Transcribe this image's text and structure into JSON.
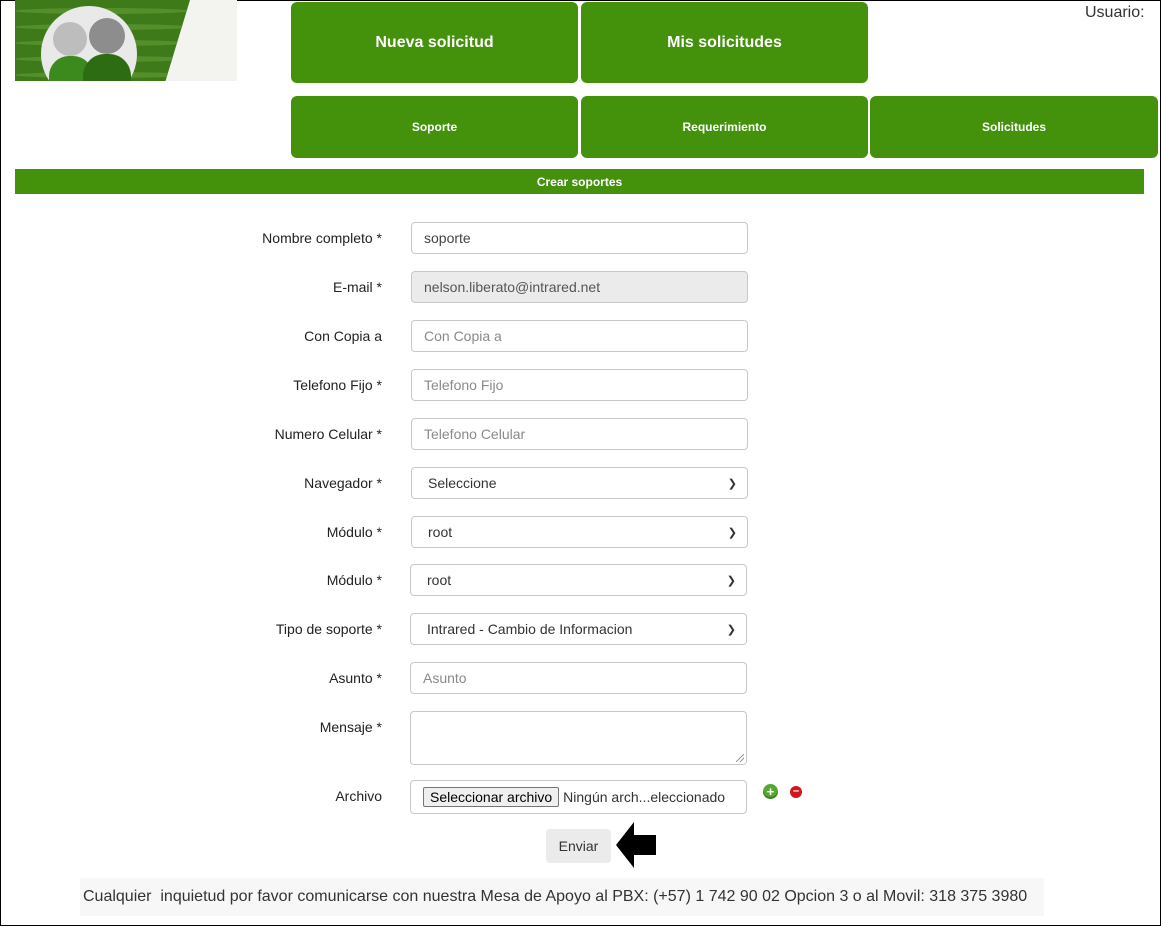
{
  "header": {
    "usuario_label": "Usuario:",
    "nav_top": [
      "Nueva solicitud",
      "Mis solicitudes"
    ],
    "nav_sub": [
      "Soporte",
      "Requerimiento",
      "Solicitudes"
    ],
    "brand_color": "#44910c"
  },
  "section_title": "Crear soportes",
  "form": {
    "nombre": {
      "label": "Nombre completo *",
      "value": "soporte"
    },
    "email": {
      "label": "E-mail *",
      "value": "nelson.liberato@intrared.net"
    },
    "copia": {
      "label": "Con Copia a",
      "placeholder": "Con Copia a"
    },
    "telefono": {
      "label": "Telefono Fijo *",
      "placeholder": "Telefono Fijo"
    },
    "celular": {
      "label": "Numero Celular *",
      "placeholder": "Telefono Celular"
    },
    "navegador": {
      "label": "Navegador *",
      "value": "Seleccione"
    },
    "modulo1": {
      "label": "Módulo *",
      "value": "root"
    },
    "modulo2": {
      "label": "Módulo *",
      "value": "root"
    },
    "tipo": {
      "label": "Tipo de soporte *",
      "value": "Intrared - Cambio de Informacion"
    },
    "asunto": {
      "label": "Asunto *",
      "placeholder": "Asunto"
    },
    "mensaje": {
      "label": "Mensaje *"
    },
    "archivo": {
      "label": "Archivo",
      "button": "Seleccionar archivo",
      "status": "Ningún arch...eleccionado"
    },
    "submit": "Enviar"
  },
  "footer": "Cualquier  inquietud por favor comunicarse con nuestra Mesa de Apoyo al PBX: (+57) 1 742 90 02 Opcion 3 o al Movil: 318 375 3980"
}
